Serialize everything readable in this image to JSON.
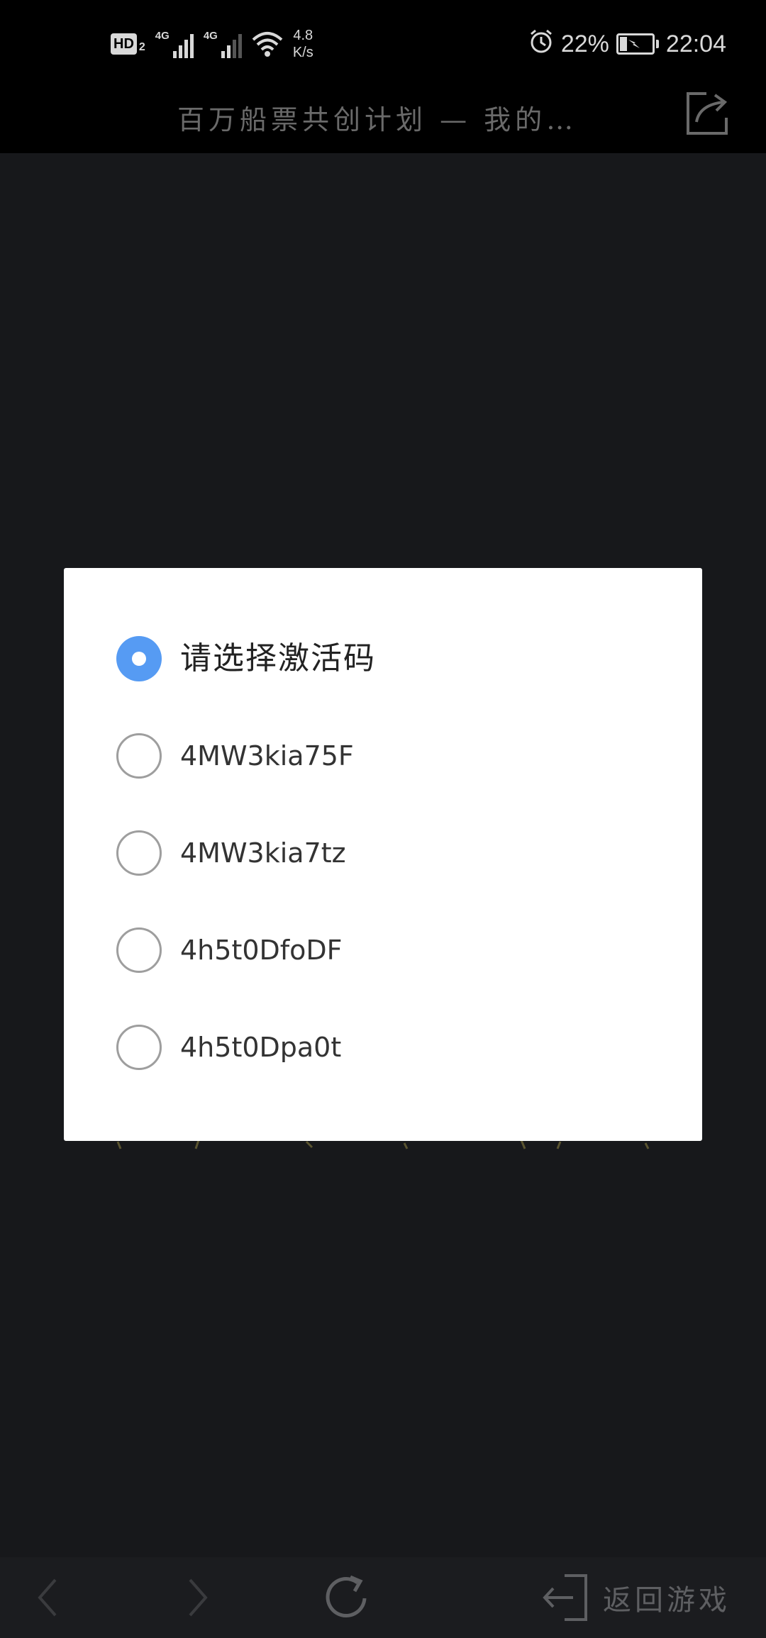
{
  "status_bar": {
    "hd_label": "HD",
    "hd_sim": "2",
    "net_type_1": "4G",
    "net_type_2": "4G",
    "speed_value": "4.8",
    "speed_unit": "K/s",
    "battery_percent_label": "22%",
    "battery_level": 0.22,
    "time": "22:04",
    "icons": [
      "alarm-icon",
      "battery-charging-icon",
      "wifi-icon",
      "signal-icon"
    ]
  },
  "header": {
    "title": "百万船票共创计划 — 我的…",
    "share_icon": "share-icon"
  },
  "dialog": {
    "options": [
      {
        "label": "请选择激活码",
        "checked": true
      },
      {
        "label": "4MW3kia75F",
        "checked": false
      },
      {
        "label": "4MW3kia7tz",
        "checked": false
      },
      {
        "label": "4h5t0DfoDF",
        "checked": false
      },
      {
        "label": "4h5t0Dpa0t",
        "checked": false
      }
    ]
  },
  "toolbar": {
    "back_icon": "chevron-left-icon",
    "forward_icon": "chevron-right-icon",
    "refresh_icon": "refresh-icon",
    "return_icon": "exit-icon",
    "return_label": "返回游戏"
  },
  "colors": {
    "accent": "#569bf3",
    "page_background": "#17181b",
    "header_background": "#000000"
  }
}
